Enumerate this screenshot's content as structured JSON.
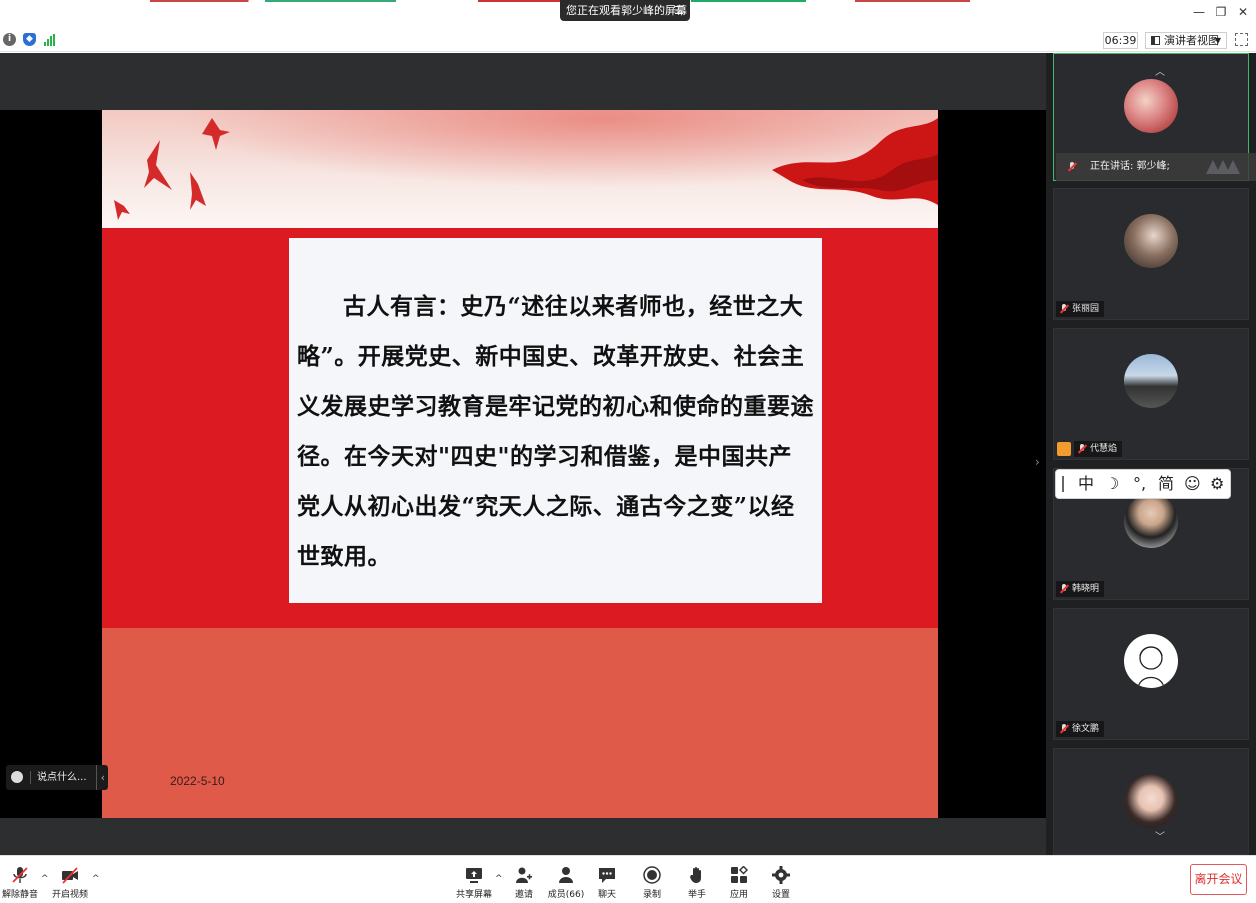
{
  "titlebar": {
    "viewing_text": "您正在观看郭少峰的屏幕",
    "menu_glyph": "☰",
    "minimize": "—",
    "restore": "❐",
    "close": "✕"
  },
  "toolbar": {
    "timer": "06:39",
    "view_mode": "演讲者视图",
    "info_icon": "info-icon",
    "shield_icon": "shield-icon",
    "signal_icon": "signal-icon"
  },
  "slide": {
    "paragraph": "古人有言：史乃“述往以来者师也，经世之大略”。开展党史、新中国史、改革开放史、社会主义发展史学习教育是牢记党的初心和使命的重要途径。在今天对\"四史\"的学习和借鉴，是中国共产党人从初心出发“究天人之际、通古今之变”以经世致用。",
    "date": "2022-5-10"
  },
  "chat": {
    "placeholder": "说点什么...",
    "collapse_glyph": "‹"
  },
  "participants": {
    "speaking_label": "正在讲话: 郭少峰;",
    "tiles": [
      {
        "name": "张丽园"
      },
      {
        "name": "代慧焰"
      },
      {
        "name": "韩晓明"
      },
      {
        "name": "徐文鹏"
      }
    ],
    "scroll_up": "︿",
    "scroll_down": "﹀"
  },
  "ime": {
    "mode": "中",
    "moon": "☽",
    "punct": "°,",
    "script": "简",
    "emoji": "☺",
    "settings": "⚙"
  },
  "bottom": {
    "unmute": "解除静音",
    "start_video": "开启视频",
    "share_screen": "共享屏幕",
    "invite": "邀请",
    "members": "成员(66)",
    "chat": "聊天",
    "record": "录制",
    "raise_hand": "举手",
    "apps": "应用",
    "settings": "设置",
    "leave": "离开会议"
  },
  "colors": {
    "slide_red": "#dc1a22",
    "slide_coral": "#e05a4a",
    "active_speaker": "#3fb96a",
    "leave_red": "#e03030"
  }
}
